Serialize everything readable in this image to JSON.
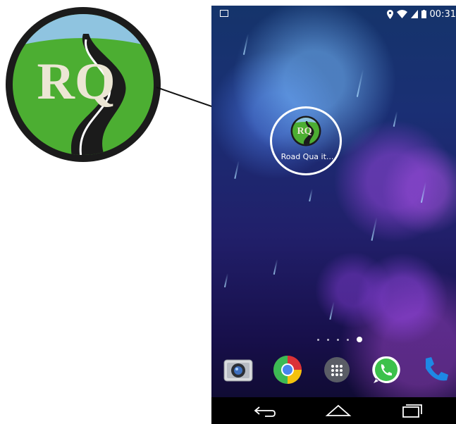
{
  "logo": {
    "initials": "RQ"
  },
  "phone": {
    "status_bar": {
      "time": "00:31"
    },
    "home": {
      "app": {
        "label": "Road Qua it...",
        "icon_letters": "RQ"
      },
      "page_count": 5,
      "current_page": 5
    },
    "dock": [
      "camera-icon",
      "chrome-icon",
      "app-drawer-icon",
      "whatsapp-icon",
      "phone-icon"
    ],
    "nav": [
      "back-icon",
      "home-icon",
      "recents-icon"
    ]
  },
  "colors": {
    "logo_green": "#4cae32",
    "logo_sky": "#8fc4e0",
    "logo_dark": "#1b1b1b",
    "logo_letters": "#ece6d4",
    "highlight": "#ffffff"
  }
}
